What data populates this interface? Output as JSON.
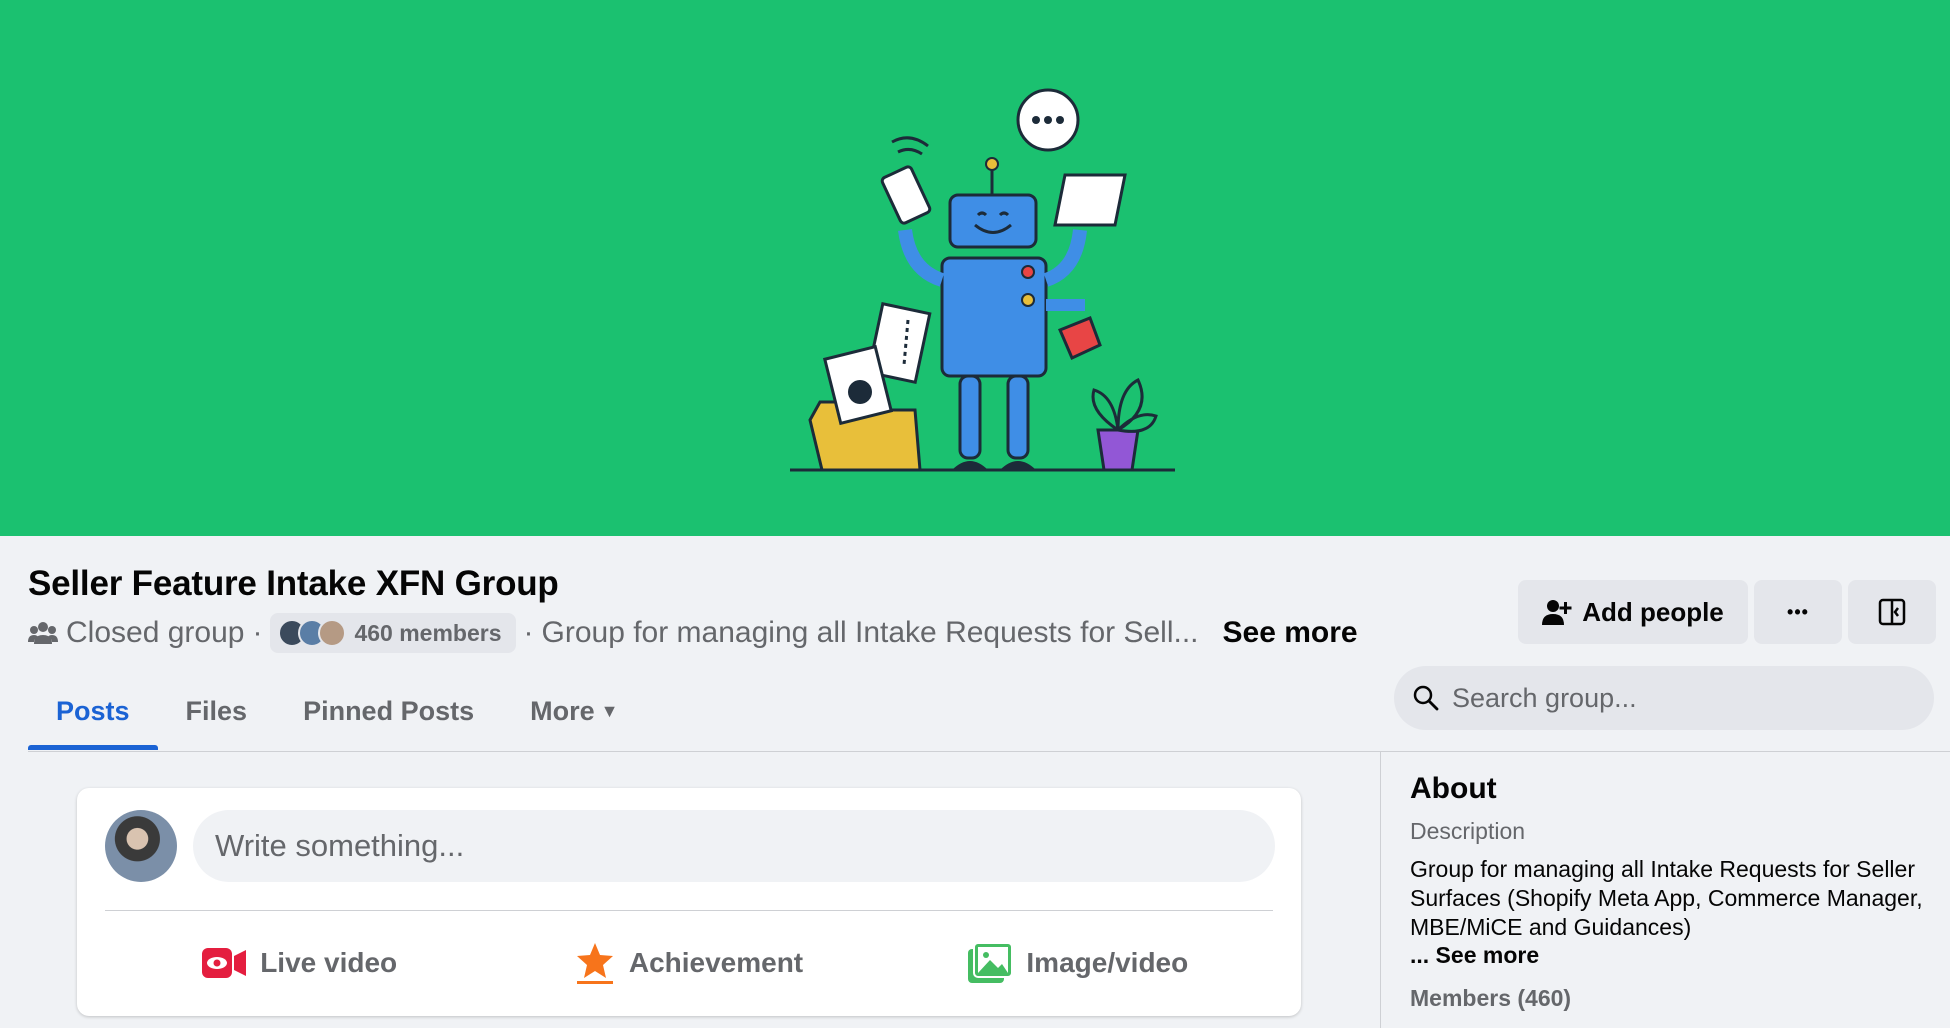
{
  "group": {
    "name": "Seller Feature Intake XFN Group",
    "privacy": "Closed group",
    "members_label": "460 members",
    "description_truncated": "Group for managing all Intake Requests for Sell...",
    "see_more": "See more"
  },
  "actions": {
    "add_people": "Add people",
    "more": "•••"
  },
  "tabs": [
    {
      "label": "Posts",
      "active": true
    },
    {
      "label": "Files",
      "active": false
    },
    {
      "label": "Pinned Posts",
      "active": false
    },
    {
      "label": "More",
      "active": false
    }
  ],
  "search": {
    "placeholder": "Search group..."
  },
  "composer": {
    "placeholder": "Write something...",
    "live_video": "Live video",
    "achievement": "Achievement",
    "image_video": "Image/video"
  },
  "about": {
    "heading": "About",
    "description_label": "Description",
    "description": "Group for managing all Intake Requests for Seller Surfaces (Shopify Meta App, Commerce Manager, MBE/MiCE and Guidances)",
    "see_more": "... See more",
    "members": "Members (460)"
  },
  "colors": {
    "cover": "#1bc170",
    "accent": "#1b63d4",
    "live": "#e41e3f",
    "achievement": "#f7741b",
    "image": "#45bd62"
  }
}
